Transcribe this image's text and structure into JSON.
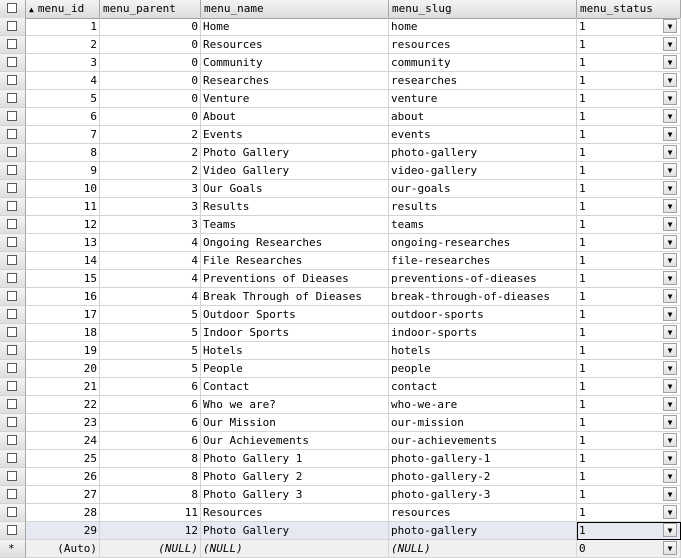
{
  "columns": [
    {
      "key": "menu_id",
      "label": "menu_id",
      "sort_icon": "sort-ascending-icon"
    },
    {
      "key": "menu_parent",
      "label": "menu_parent"
    },
    {
      "key": "menu_name",
      "label": "menu_name"
    },
    {
      "key": "menu_slug",
      "label": "menu_slug"
    },
    {
      "key": "menu_status",
      "label": "menu_status"
    }
  ],
  "rows": [
    {
      "id": "1",
      "parent": "0",
      "name": "Home",
      "slug": "home",
      "status": "1"
    },
    {
      "id": "2",
      "parent": "0",
      "name": "Resources",
      "slug": "resources",
      "status": "1"
    },
    {
      "id": "3",
      "parent": "0",
      "name": "Community",
      "slug": "community",
      "status": "1"
    },
    {
      "id": "4",
      "parent": "0",
      "name": "Researches",
      "slug": "researches",
      "status": "1"
    },
    {
      "id": "5",
      "parent": "0",
      "name": "Venture",
      "slug": "venture",
      "status": "1"
    },
    {
      "id": "6",
      "parent": "0",
      "name": "About",
      "slug": "about",
      "status": "1"
    },
    {
      "id": "7",
      "parent": "2",
      "name": "Events",
      "slug": "events",
      "status": "1"
    },
    {
      "id": "8",
      "parent": "2",
      "name": "Photo Gallery",
      "slug": "photo-gallery",
      "status": "1"
    },
    {
      "id": "9",
      "parent": "2",
      "name": "Video Gallery",
      "slug": "video-gallery",
      "status": "1"
    },
    {
      "id": "10",
      "parent": "3",
      "name": "Our Goals",
      "slug": "our-goals",
      "status": "1"
    },
    {
      "id": "11",
      "parent": "3",
      "name": "Results",
      "slug": "results",
      "status": "1"
    },
    {
      "id": "12",
      "parent": "3",
      "name": "Teams",
      "slug": "teams",
      "status": "1"
    },
    {
      "id": "13",
      "parent": "4",
      "name": "Ongoing Researches",
      "slug": "ongoing-researches",
      "status": "1"
    },
    {
      "id": "14",
      "parent": "4",
      "name": "File Researches",
      "slug": "file-researches",
      "status": "1"
    },
    {
      "id": "15",
      "parent": "4",
      "name": "Preventions of Dieases",
      "slug": "preventions-of-dieases",
      "status": "1"
    },
    {
      "id": "16",
      "parent": "4",
      "name": "Break Through of Dieases",
      "slug": "break-through-of-dieases",
      "status": "1"
    },
    {
      "id": "17",
      "parent": "5",
      "name": "Outdoor Sports",
      "slug": "outdoor-sports",
      "status": "1"
    },
    {
      "id": "18",
      "parent": "5",
      "name": "Indoor Sports",
      "slug": "indoor-sports",
      "status": "1"
    },
    {
      "id": "19",
      "parent": "5",
      "name": "Hotels",
      "slug": "hotels",
      "status": "1"
    },
    {
      "id": "20",
      "parent": "5",
      "name": "People",
      "slug": "people",
      "status": "1"
    },
    {
      "id": "21",
      "parent": "6",
      "name": "Contact",
      "slug": "contact",
      "status": "1"
    },
    {
      "id": "22",
      "parent": "6",
      "name": "Who we are?",
      "slug": "who-we-are",
      "status": "1"
    },
    {
      "id": "23",
      "parent": "6",
      "name": "Our Mission",
      "slug": "our-mission",
      "status": "1"
    },
    {
      "id": "24",
      "parent": "6",
      "name": "Our Achievements",
      "slug": "our-achievements",
      "status": "1"
    },
    {
      "id": "25",
      "parent": "8",
      "name": "Photo Gallery 1",
      "slug": "photo-gallery-1",
      "status": "1"
    },
    {
      "id": "26",
      "parent": "8",
      "name": "Photo Gallery 2",
      "slug": "photo-gallery-2",
      "status": "1"
    },
    {
      "id": "27",
      "parent": "8",
      "name": "Photo Gallery 3",
      "slug": "photo-gallery-3",
      "status": "1"
    },
    {
      "id": "28",
      "parent": "11",
      "name": "Resources",
      "slug": "resources",
      "status": "1"
    },
    {
      "id": "29",
      "parent": "12",
      "name": "Photo Gallery",
      "slug": "photo-gallery",
      "status": "1"
    }
  ],
  "new_row": {
    "marker": "*",
    "id": "(Auto)",
    "parent": "(NULL)",
    "name": "(NULL)",
    "slug": "(NULL)",
    "status": "0"
  },
  "current_row_index": 28,
  "colors": {
    "header_bg": "#dcdcdc",
    "current_row_bg": "#e6e9f2",
    "grid_line": "#d4d4d4"
  }
}
